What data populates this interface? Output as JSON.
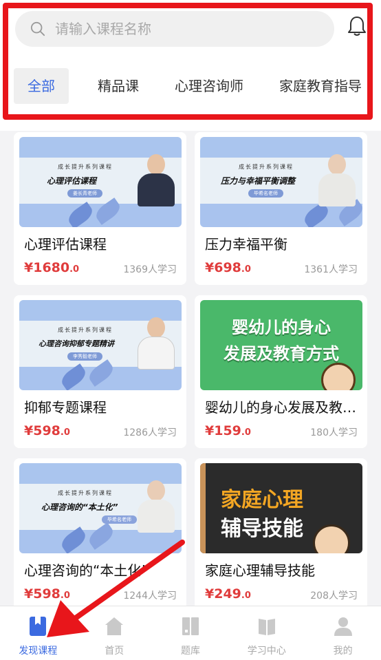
{
  "search": {
    "placeholder": "请输入课程名称"
  },
  "tabs": [
    {
      "label": "全部",
      "active": true
    },
    {
      "label": "精品课"
    },
    {
      "label": "心理咨询师"
    },
    {
      "label": "家庭教育指导"
    }
  ],
  "thumb_common": {
    "series": "成长提升系列课程"
  },
  "courses": [
    {
      "thumb_title": "心理评估课程",
      "teacher": "姜长青老师",
      "title": "心理评估课程",
      "price_int": "¥1680",
      "price_dec": ".0",
      "learners": "1369人学习"
    },
    {
      "thumb_title": "压力与幸福平衡调整",
      "teacher": "毕希名老师",
      "title": "压力幸福平衡",
      "price_int": "¥698",
      "price_dec": ".0",
      "learners": "1361人学习"
    },
    {
      "thumb_title": "心理咨询抑郁专题精讲",
      "teacher": "李秀毅老师",
      "title": "抑郁专题课程",
      "price_int": "¥598",
      "price_dec": ".0",
      "learners": "1286人学习"
    },
    {
      "thumb_line1": "婴幼儿的身心",
      "thumb_line2": "发展及教育方式",
      "title": "婴幼儿的身心发展及教育方式",
      "price_int": "¥159",
      "price_dec": ".0",
      "learners": "180人学习"
    },
    {
      "thumb_title": "心理咨询的“本土化”",
      "teacher": "毕希名老师",
      "title": "心理咨询的“本土化”",
      "price_int": "¥598",
      "price_dec": ".0",
      "learners": "1244人学习"
    },
    {
      "thumb_line1": "家庭心理",
      "thumb_line2": "辅导技能",
      "title": "家庭心理辅导技能",
      "price_int": "¥249",
      "price_dec": ".0",
      "learners": "208人学习"
    }
  ],
  "nav": [
    {
      "label": "发现课程",
      "icon": "bookmark-book-icon",
      "active": true
    },
    {
      "label": "首页",
      "icon": "home-icon"
    },
    {
      "label": "题库",
      "icon": "question-bank-icon"
    },
    {
      "label": "学习中心",
      "icon": "open-book-icon"
    },
    {
      "label": "我的",
      "icon": "user-icon"
    }
  ],
  "colors": {
    "accent": "#3b6ae0",
    "price": "#e03c3c",
    "annotation": "#e8161b"
  }
}
